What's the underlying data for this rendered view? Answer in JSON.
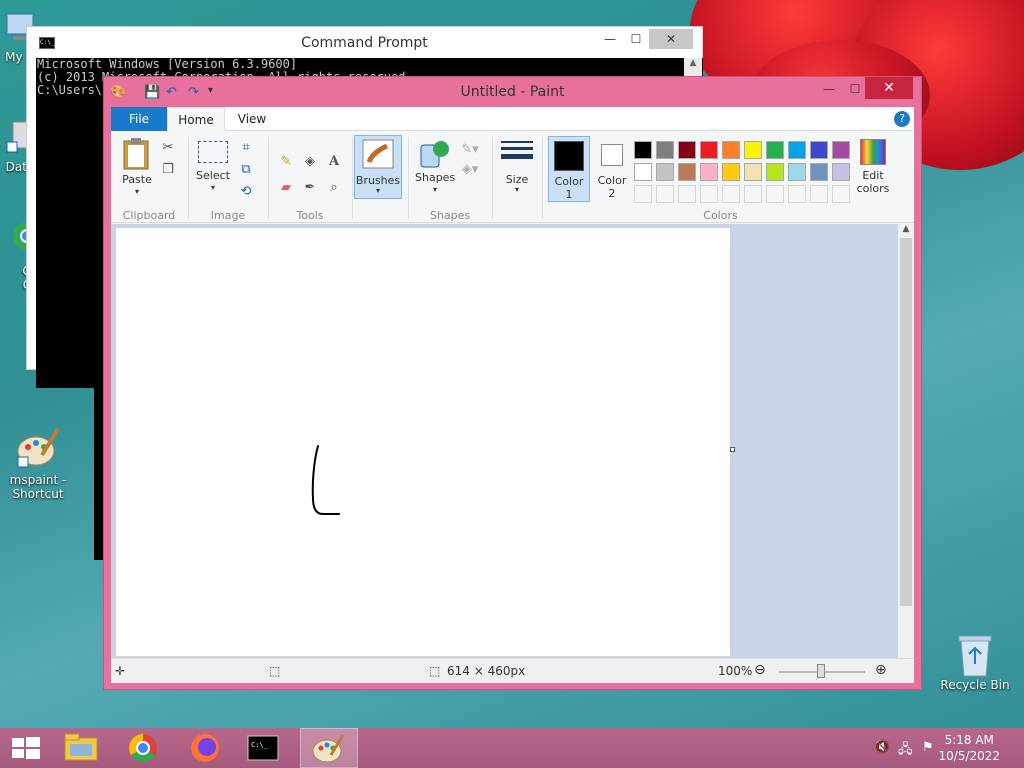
{
  "desktop": {
    "icons": [
      {
        "label": "My C",
        "name": "my-computer"
      },
      {
        "label": "Data",
        "name": "data"
      },
      {
        "label": "G",
        "label2": "C",
        "name": "google-chrome"
      },
      {
        "label": "mspaint -",
        "label2": "Shortcut",
        "name": "mspaint-shortcut"
      },
      {
        "label": "Recycle Bin",
        "name": "recycle-bin"
      }
    ]
  },
  "cmd": {
    "title": "Command Prompt",
    "lines": [
      "Microsoft Windows [Version 6.3.9600]",
      "(c) 2013 Microsoft Corporation. All rights reserved.",
      "",
      "C:\\Users\\"
    ]
  },
  "paint": {
    "title": "Untitled - Paint",
    "tabs": {
      "file": "File",
      "home": "Home",
      "view": "View"
    },
    "help": "?",
    "groups": {
      "clipboard": "Clipboard",
      "image": "Image",
      "tools": "Tools",
      "shapes": "Shapes",
      "colors": "Colors"
    },
    "buttons": {
      "paste": "Paste",
      "select": "Select",
      "brushes": "Brushes",
      "shapes": "Shapes",
      "size": "Size",
      "color1": "Color",
      "color1_num": "1",
      "color2": "Color",
      "color2_num": "2",
      "edit_colors": "Edit",
      "edit_colors2": "colors"
    },
    "palette_row1": [
      "#000000",
      "#7f7f7f",
      "#880015",
      "#ed1c24",
      "#ff7f27",
      "#fff200",
      "#22b14c",
      "#00a2e8",
      "#3f48cc",
      "#a349a4"
    ],
    "palette_row2": [
      "#ffffff",
      "#c3c3c3",
      "#b97a57",
      "#ffaec9",
      "#ffc90e",
      "#efe4b0",
      "#b5e61d",
      "#99d9ea",
      "#7092be",
      "#c8bfe7"
    ],
    "color1_value": "#000000",
    "color2_value": "#ffffff",
    "status": {
      "size": "614 × 460px",
      "zoom": "100%"
    }
  },
  "taskbar": {
    "time": "5:18 AM",
    "date": "10/5/2022"
  }
}
